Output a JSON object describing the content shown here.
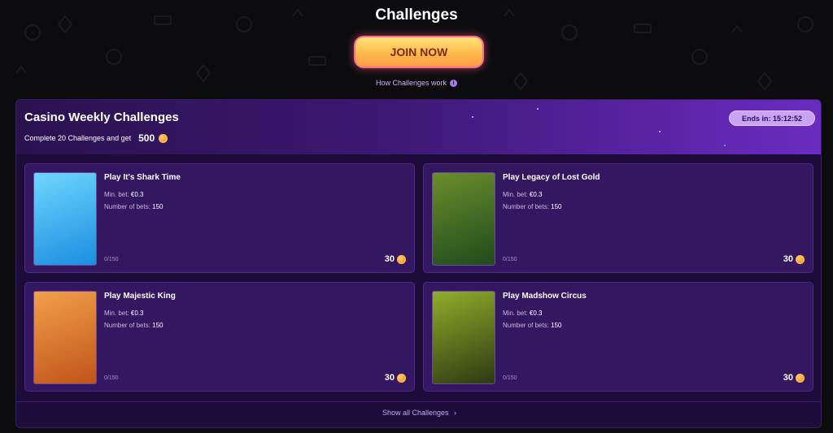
{
  "page": {
    "title": "Challenges",
    "join_label": "JOIN NOW",
    "how_label": "How Challenges work",
    "info_glyph": "i"
  },
  "panel": {
    "title": "Casino Weekly Challenges",
    "subtitle": "Complete 20 Challenges and get",
    "reward_total": "500",
    "ends_label": "Ends in: 15:12:52",
    "show_all_label": "Show all Challenges",
    "show_all_chevron": "›"
  },
  "cards": [
    {
      "name": "Play It's Shark Time",
      "min_bet_label": "Min. bet:",
      "min_bet": "€0.3",
      "bets_label": "Number of bets:",
      "bets": "150",
      "progress": "0/150",
      "reward": "30",
      "thumb_icon": "shark-time-thumbnail",
      "thumb_colors": [
        "#1a8ee0",
        "#6fd6ff"
      ]
    },
    {
      "name": "Play Legacy of Lost Gold",
      "min_bet_label": "Min. bet:",
      "min_bet": "€0.3",
      "bets_label": "Number of bets:",
      "bets": "150",
      "progress": "0/150",
      "reward": "30",
      "thumb_icon": "legacy-lost-gold-thumbnail",
      "thumb_colors": [
        "#1f4a1c",
        "#6a8e2c"
      ]
    },
    {
      "name": "Play Majestic King",
      "min_bet_label": "Min. bet:",
      "min_bet": "€0.3",
      "bets_label": "Number of bets:",
      "bets": "150",
      "progress": "0/150",
      "reward": "30",
      "thumb_icon": "majestic-king-thumbnail",
      "thumb_colors": [
        "#c2531a",
        "#f0a04a"
      ]
    },
    {
      "name": "Play Madshow Circus",
      "min_bet_label": "Min. bet:",
      "min_bet": "€0.3",
      "bets_label": "Number of bets:",
      "bets": "150",
      "progress": "0/150",
      "reward": "30",
      "thumb_icon": "madshow-circus-thumbnail",
      "thumb_colors": [
        "#2c3a12",
        "#8fae2a"
      ]
    }
  ],
  "colors": {
    "accent": "#8b45ff",
    "join_gradient_top": "#ffe27a",
    "join_border": "#ff6b8a",
    "coin": "#f39a2b"
  }
}
